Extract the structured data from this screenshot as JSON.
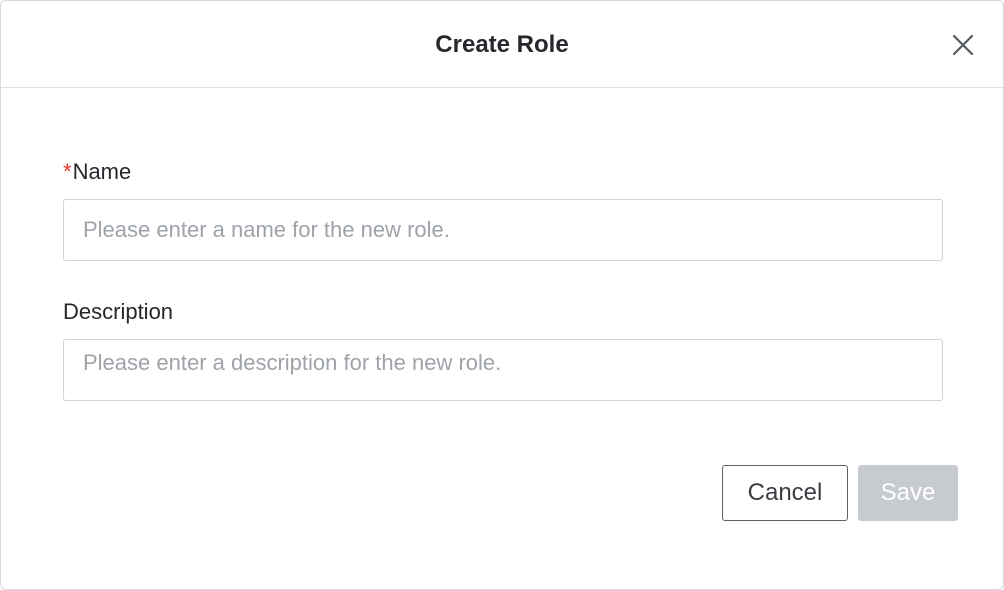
{
  "dialog": {
    "title": "Create Role",
    "close_icon": "close-icon"
  },
  "form": {
    "name": {
      "required_mark": "*",
      "label": "Name",
      "value": "",
      "placeholder": "Please enter a name for the new role."
    },
    "description": {
      "label": "Description",
      "value": "",
      "placeholder": "Please enter a description for the new role."
    }
  },
  "actions": {
    "cancel_label": "Cancel",
    "save_label": "Save",
    "save_disabled": true
  },
  "colors": {
    "required": "#e0362f",
    "save_disabled_bg": "#c7cace",
    "text": "#25282c",
    "placeholder": "#9ea3aa"
  }
}
